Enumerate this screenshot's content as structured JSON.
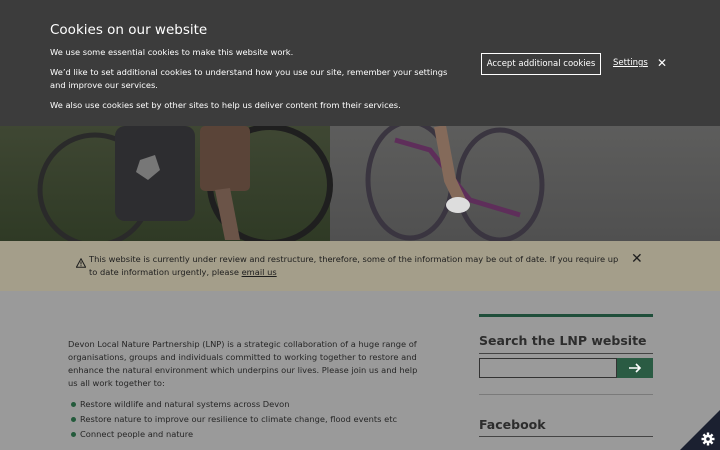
{
  "cookie": {
    "title": "Cookies on our website",
    "p1": "We use some essential cookies to make this website work.",
    "p2": "We’d like to set additional cookies to understand how you use our site, remember your settings and improve our services.",
    "p3": "We also use cookies set by other sites to help us deliver content from their services.",
    "accept_label": "Accept additional cookies",
    "settings_label": "Settings",
    "close_glyph": "✕"
  },
  "notice": {
    "icon": "warning-icon",
    "text": "This website is currently under review and restructure, therefore, some of the information may be out of date. If you require up to date information urgently, please",
    "link": "email us",
    "close_glyph": "✕"
  },
  "main": {
    "intro": "Devon Local Nature Partnership (LNP) is a strategic collaboration of a huge range of organisations, groups and individuals committed to working together to restore and enhance the natural environment which underpins our lives. Please join us and help us all work together to:",
    "bullets": [
      "Restore wildlife and natural systems across Devon",
      "Restore nature to improve our resilience to climate change, flood events etc",
      "Connect people and nature"
    ]
  },
  "sidebar": {
    "search_title": "Search the LNP website",
    "search_placeholder": "",
    "search_button_icon": "arrow-right-icon",
    "facebook_title": "Facebook"
  },
  "colors": {
    "banner": "#3c3c3c",
    "notice": "#a49e8a",
    "accent_green": "#2a5b43"
  }
}
